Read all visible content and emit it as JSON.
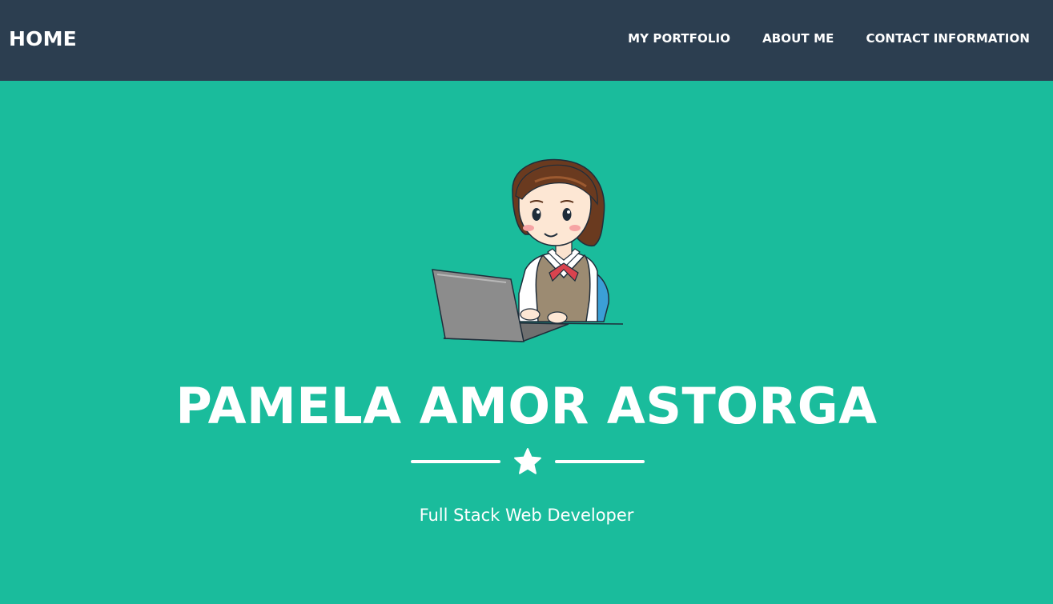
{
  "navbar": {
    "brand": "HOME",
    "links": [
      {
        "label": "MY PORTFOLIO"
      },
      {
        "label": "ABOUT ME"
      },
      {
        "label": "CONTACT INFORMATION"
      }
    ]
  },
  "masthead": {
    "avatar_icon": "woman-at-laptop-illustration",
    "name": "PAMELA AMOR ASTORGA",
    "divider_icon": "star-icon",
    "subtitle": "Full Stack Web Developer"
  },
  "colors": {
    "navbar_bg": "#2c3e50",
    "hero_bg": "#1abc9c",
    "text": "#ffffff"
  }
}
